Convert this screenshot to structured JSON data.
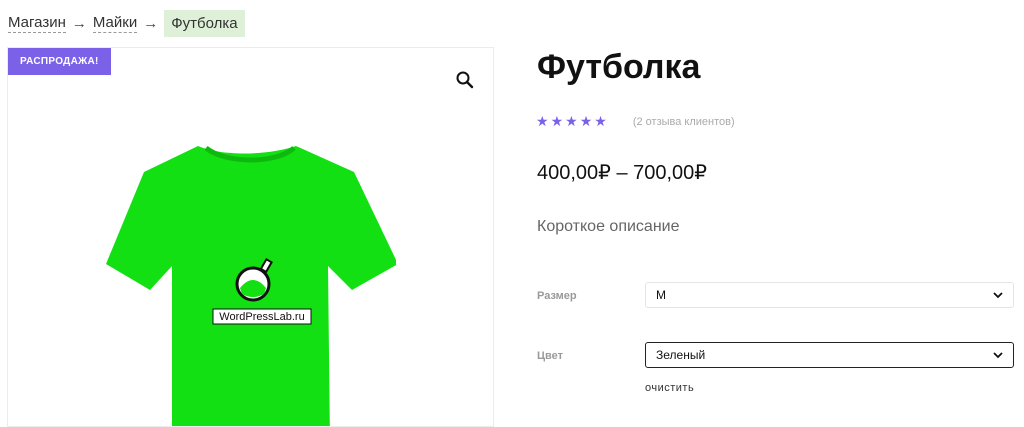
{
  "breadcrumb": {
    "items": [
      "Магазин",
      "Майки"
    ],
    "separator": "→",
    "current": "Футболка"
  },
  "gallery": {
    "badge": "РАСПРОДАЖА!",
    "zoom_icon": "search-icon",
    "logo_text": "WordPressLab.ru",
    "shirt_color": "#12e012"
  },
  "product": {
    "title": "Футболка",
    "rating": 5,
    "review_text": "(2 отзыва клиентов)",
    "price": "400,00₽ – 700,00₽",
    "short_description": "Короткое описание"
  },
  "variations": {
    "size": {
      "label": "Размер",
      "value": "M"
    },
    "color": {
      "label": "Цвет",
      "value": "Зеленый"
    },
    "clear_label": "очистить"
  },
  "colors": {
    "accent": "#7b61e8",
    "breadcrumb_highlight": "#dff0d8"
  }
}
